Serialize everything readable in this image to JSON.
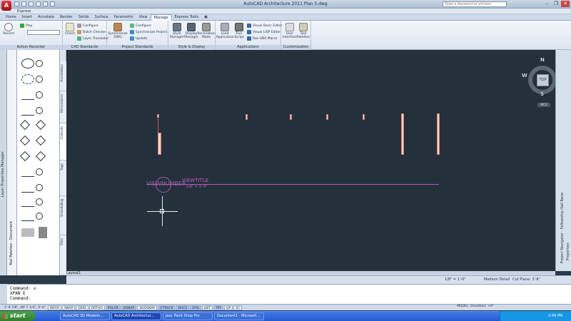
{
  "window": {
    "title": "AutoCAD Architecture 2011    Plan 5.dwg"
  },
  "app_button": {
    "label": "A"
  },
  "search": {
    "placeholder": "Type a keyword or phrase"
  },
  "workspace": {
    "label": "Express"
  },
  "tabs": [
    {
      "label": "Home"
    },
    {
      "label": "Insert"
    },
    {
      "label": "Annotate"
    },
    {
      "label": "Render"
    },
    {
      "label": "Solids"
    },
    {
      "label": "Surface"
    },
    {
      "label": "Parametric"
    },
    {
      "label": "View"
    },
    {
      "label": "Manage"
    },
    {
      "label": "Express Tools"
    },
    {
      "label": "▣"
    }
  ],
  "active_tab": "Manage",
  "ribbon": {
    "action_recorder": {
      "record": "Record",
      "play": "Play",
      "title": "Action Recorder"
    },
    "cad_standards": {
      "check": "Check",
      "configure": "Configure",
      "batch_checker": "Batch Checker",
      "layer_translator": "Layer Translator",
      "title": "CAD Standards"
    },
    "project_standards": {
      "synchronize_dwg": "Synchronize DWG",
      "configure": "Configure",
      "synchronize_project": "Synchronize Project",
      "update": "Update",
      "title": "Project Standards"
    },
    "style_display": {
      "style_manager": "Style Manager",
      "display_manager": "Display Manager",
      "renovation_mode": "Renovation Mode",
      "title": "Style & Display"
    },
    "applications": {
      "load_application": "Load Application",
      "run_script": "Run Script",
      "vb_editor": "Visual Basic Editor",
      "lisp_editor": "Visual LISP Editor",
      "run_vba": "Run VBA Macro",
      "title": "Applications"
    },
    "customization": {
      "user_interface": "User Interface",
      "tool_palettes": "Tool Palettes",
      "title": "Customization"
    }
  },
  "left_strip": {
    "layer_manager": "Layer Properties Manager",
    "tool_palettes": "Tool Palettes - Document"
  },
  "palette_tabs": [
    "Annotation",
    "Dimensions",
    "Callouts",
    "Tags",
    "Scheduling",
    "Tiles"
  ],
  "canvas": {
    "view_number": "VIEWNUMBER",
    "view_title": "VIEWTITLE",
    "view_scale": "1/8\" = 1'-0\""
  },
  "viewcube": {
    "top": "TOP",
    "n": "N",
    "s": "S",
    "e": "E",
    "w": "W",
    "wcs": "WCS"
  },
  "right_strip": {
    "project_navigator": "Project Navigator - Fellowship Hall Reno",
    "properties": "Properties"
  },
  "drawing_status": {
    "scale": "1/8\" = 1'-0\"",
    "detail": "Medium Detail",
    "cut_plane": "Cut Plane: 3'-6\"",
    "layout_tab": "Layout1"
  },
  "command": {
    "lines": [
      "Command: u",
      "XPAN E",
      "Command:"
    ]
  },
  "statusbar": {
    "coords": "1'-9 7/8\", 49'-7 1/4\", 0'-0\"",
    "toggles": [
      "INFER",
      "SNAP",
      "GRID",
      "ORTHO",
      "POLAR",
      "OSNAP",
      "3DOSNAP",
      "OTRACK",
      "DUCS",
      "DYN",
      "LWT",
      "TPY",
      "QP",
      "SC"
    ],
    "model": "MODEL",
    "elevation": "Elevation: +0\""
  },
  "taskbar": {
    "start": "start",
    "items": [
      "AutoCAD 3D Modelin...",
      "AutoCAD Architectur...",
      "Jasc Paint Shop Pro",
      "Document1 - Microsof..."
    ],
    "clock": "2:49 PM"
  },
  "colors": {
    "canvas": "#24303b",
    "accent": "#b357b8",
    "wall_fill": "#f0d6c8",
    "wall_edge": "#d47a6a"
  }
}
